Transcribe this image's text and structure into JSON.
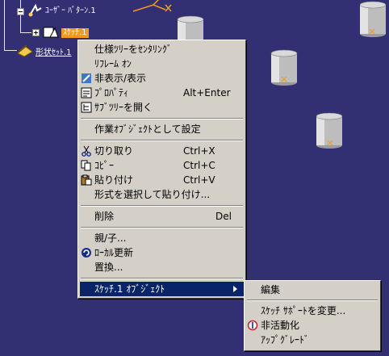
{
  "tree": {
    "pattern_label": "ﾕｰｻﾞｰ ﾊﾟﾀｰﾝ.1",
    "sketch_label": "ｽｹｯﾁ.1",
    "geoset_label": "形状ｾｯﾄ.1"
  },
  "context_menu": {
    "items": [
      {
        "label": "仕様ﾂﾘｰをｾﾝﾀﾘﾝｸﾞ",
        "shortcut": ""
      },
      {
        "label": "ﾘﾌﾚｰﾑ ｵﾝ",
        "shortcut": ""
      },
      {
        "label": "非表示/表示",
        "shortcut": ""
      },
      {
        "label": "ﾌﾟﾛﾊﾟﾃｨ",
        "shortcut": "Alt+Enter"
      },
      {
        "label": "ｻﾌﾞﾂﾘｰを開く",
        "shortcut": ""
      },
      {
        "label": "作業ｵﾌﾞｼﾞｪｸﾄとして設定",
        "shortcut": ""
      },
      {
        "label": "切り取り",
        "shortcut": "Ctrl+X"
      },
      {
        "label": "ｺﾋﾟｰ",
        "shortcut": "Ctrl+C"
      },
      {
        "label": "貼り付け",
        "shortcut": "Ctrl+V"
      },
      {
        "label": "形式を選択して貼り付け...",
        "shortcut": ""
      },
      {
        "label": "削除",
        "shortcut": "Del"
      },
      {
        "label": "親/子...",
        "shortcut": ""
      },
      {
        "label": "ﾛｰｶﾙ更新",
        "shortcut": ""
      },
      {
        "label": "置換...",
        "shortcut": ""
      },
      {
        "label": "ｽｹｯﾁ.1 ｵﾌﾞｼﾞｪｸﾄ",
        "shortcut": ""
      }
    ]
  },
  "submenu": {
    "items": [
      {
        "label": "編集"
      },
      {
        "label": "ｽｹｯﾁ ｻﾎﾟｰﾄを変更..."
      },
      {
        "label": "非活動化"
      },
      {
        "label": "ｱｯﾌﾟｸﾞﾚｰﾄﾞ"
      }
    ]
  },
  "colors": {
    "background": "#332f73",
    "menu_bg": "#d4d0c8",
    "highlight": "#0a246a",
    "selection": "#f29a1f"
  }
}
